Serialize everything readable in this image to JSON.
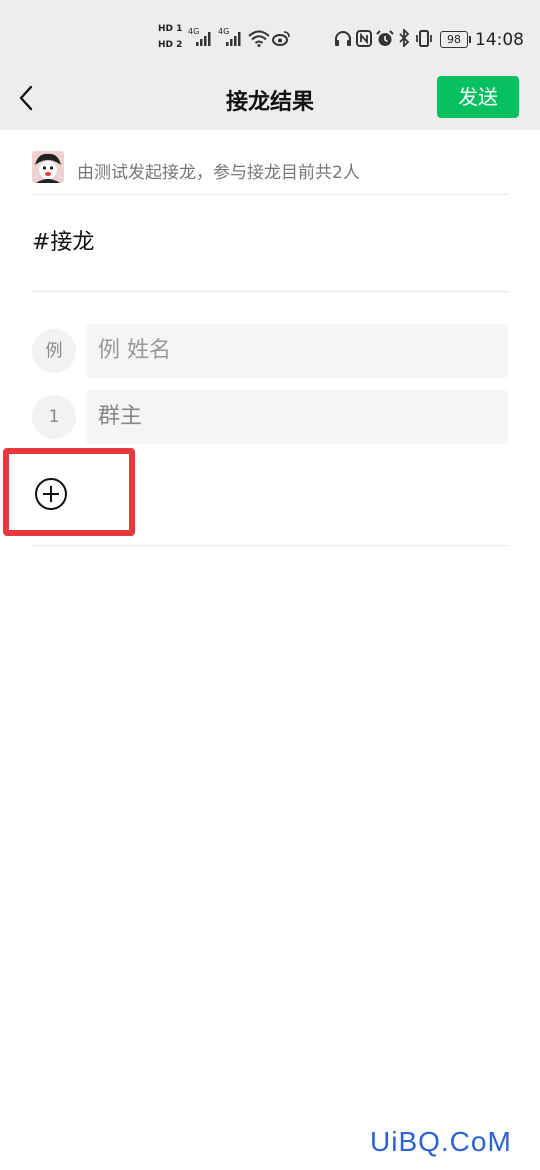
{
  "status_bar": {
    "sim1": "HD 1",
    "sim2": "HD 2",
    "net1": "4G",
    "net2": "4G",
    "battery": "98",
    "time": "14:08",
    "icons": [
      "signal-icon",
      "wifi-icon",
      "weibo-icon",
      "headphones-icon",
      "nfc-icon",
      "alarm-icon",
      "bluetooth-icon",
      "vibrate-icon",
      "battery-icon"
    ]
  },
  "navbar": {
    "title": "接龙结果",
    "send_label": "发送",
    "accent": "#07c160"
  },
  "info": {
    "text": "由测试发起接龙，参与接龙目前共2人"
  },
  "topic": "#接龙",
  "entries": [
    {
      "badge": "例",
      "value": "例 姓名"
    },
    {
      "badge": "1",
      "value": "群主"
    }
  ],
  "highlight_color": "#e8383d",
  "watermark": "UiBQ.CoM"
}
